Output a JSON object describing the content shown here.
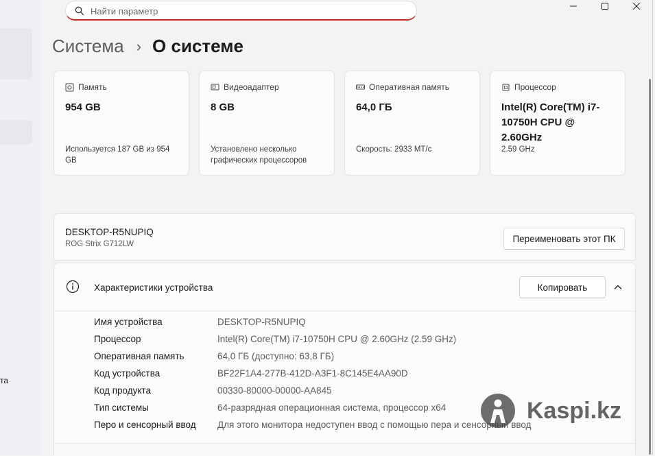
{
  "search": {
    "placeholder": "Найти параметр"
  },
  "left_nav": {
    "fragment": "та"
  },
  "breadcrumb": {
    "parent": "Система",
    "separator": "›",
    "current": "О системе"
  },
  "cards": [
    {
      "icon": "storage-icon",
      "title": "Память",
      "value": "954 GB",
      "sub": "Используется 187 GB из 954 GB"
    },
    {
      "icon": "display-adapter-icon",
      "title": "Видеоадаптер",
      "value": "8 GB",
      "sub": "Установлено несколько графических процессоров"
    },
    {
      "icon": "ram-icon",
      "title": "Оперативная память",
      "value": "64,0 ГБ",
      "sub": "Скорость: 2933 МТ/с"
    },
    {
      "icon": "cpu-icon",
      "title": "Процессор",
      "value": "Intel(R) Core(TM) i7-10750H CPU @ 2.60GHz",
      "sub": "2.59 GHz"
    }
  ],
  "pc": {
    "name": "DESKTOP-R5NUPIQ",
    "model": "ROG Strix G712LW",
    "rename_label": "Переименовать этот ПК"
  },
  "specs": {
    "title": "Характеристики устройства",
    "copy_label": "Копировать",
    "rows": [
      {
        "key": "Имя устройства",
        "value": "DESKTOP-R5NUPIQ"
      },
      {
        "key": "Процессор",
        "value": "Intel(R) Core(TM) i7-10750H CPU @ 2.60GHz (2.59 GHz)"
      },
      {
        "key": "Оперативная память",
        "value": "64,0 ГБ (доступно: 63,8 ГБ)"
      },
      {
        "key": "Код устройства",
        "value": "BF22F1A4-277B-412D-A3F1-8C145E4AA90D"
      },
      {
        "key": "Код продукта",
        "value": "00330-80000-00000-AA845"
      },
      {
        "key": "Тип системы",
        "value": "64-разрядная операционная система, процессор x64"
      },
      {
        "key": "Перо и сенсорный ввод",
        "value": "Для этого монитора недоступен ввод с помощью пера и сенсорный ввод"
      }
    ]
  },
  "watermark": {
    "text": "Kaspi.kz"
  },
  "colors": {
    "accent": "#c42b1c",
    "background": "#f3f3f3",
    "card": "#fbfbfb"
  }
}
